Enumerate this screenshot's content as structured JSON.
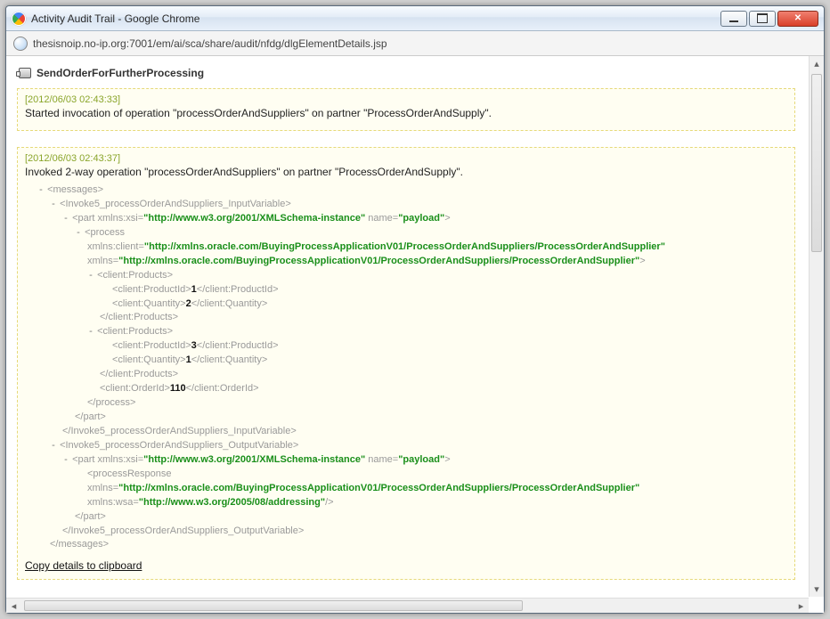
{
  "window": {
    "title": "Activity Audit Trail - Google Chrome",
    "url": "thesisnoip.no-ip.org:7001/em/ai/sca/share/audit/nfdg/dlgElementDetails.jsp"
  },
  "heading": "SendOrderForFurtherProcessing",
  "box1": {
    "timestamp": "[2012/06/03 02:43:33]",
    "summary": "Started invocation of operation \"processOrderAndSuppliers\" on partner \"ProcessOrderAndSupply\"."
  },
  "box2": {
    "timestamp": "[2012/06/03 02:43:37]",
    "summary": "Invoked 2-way operation \"processOrderAndSuppliers\" on partner \"ProcessOrderAndSupply\".",
    "copy_link": "Copy details to clipboard",
    "xml": {
      "messages_open": "<messages>",
      "messages_close": "</messages>",
      "inputvar_open": "<Invoke5_processOrderAndSuppliers_InputVariable>",
      "inputvar_close": "</Invoke5_processOrderAndSuppliers_InputVariable>",
      "outputvar_open": "<Invoke5_processOrderAndSuppliers_OutputVariable>",
      "outputvar_close": "</Invoke5_processOrderAndSuppliers_OutputVariable>",
      "part_open_prefix": "<part ",
      "part_close_suffix": ">",
      "part_close": "</part>",
      "xmlns_xsi_label": "xmlns:xsi=",
      "xmlns_xsi_val": "\"http://www.w3.org/2001/XMLSchema-instance\"",
      "name_label": " name=",
      "name_val": "\"payload\"",
      "process_open": "<process",
      "process_close": "</process>",
      "process_resp_open": "<processResponse",
      "xmlns_client_label": "xmlns:client=",
      "xmlns_label": "xmlns=",
      "xmlns_wsa_label": "xmlns:wsa=",
      "client_ns_val": "\"http://xmlns.oracle.com/BuyingProcessApplicationV01/ProcessOrderAndSuppliers/ProcessOrderAndSupplier\"",
      "wsa_ns_val": "\"http://www.w3.org/2005/08/addressing\"",
      "self_close": "/>",
      "close_gt": ">",
      "products_open": "<client:Products>",
      "products_close": "</client:Products>",
      "productid_open": "<client:ProductId>",
      "productid_close": "</client:ProductId>",
      "quantity_open": "<client:Quantity>",
      "quantity_close": "</client:Quantity>",
      "orderid_open": "<client:OrderId>",
      "orderid_close": "</client:OrderId>",
      "p1_id": "1",
      "p1_qty": "2",
      "p2_id": "3",
      "p2_qty": "1",
      "order_id": "110"
    }
  }
}
